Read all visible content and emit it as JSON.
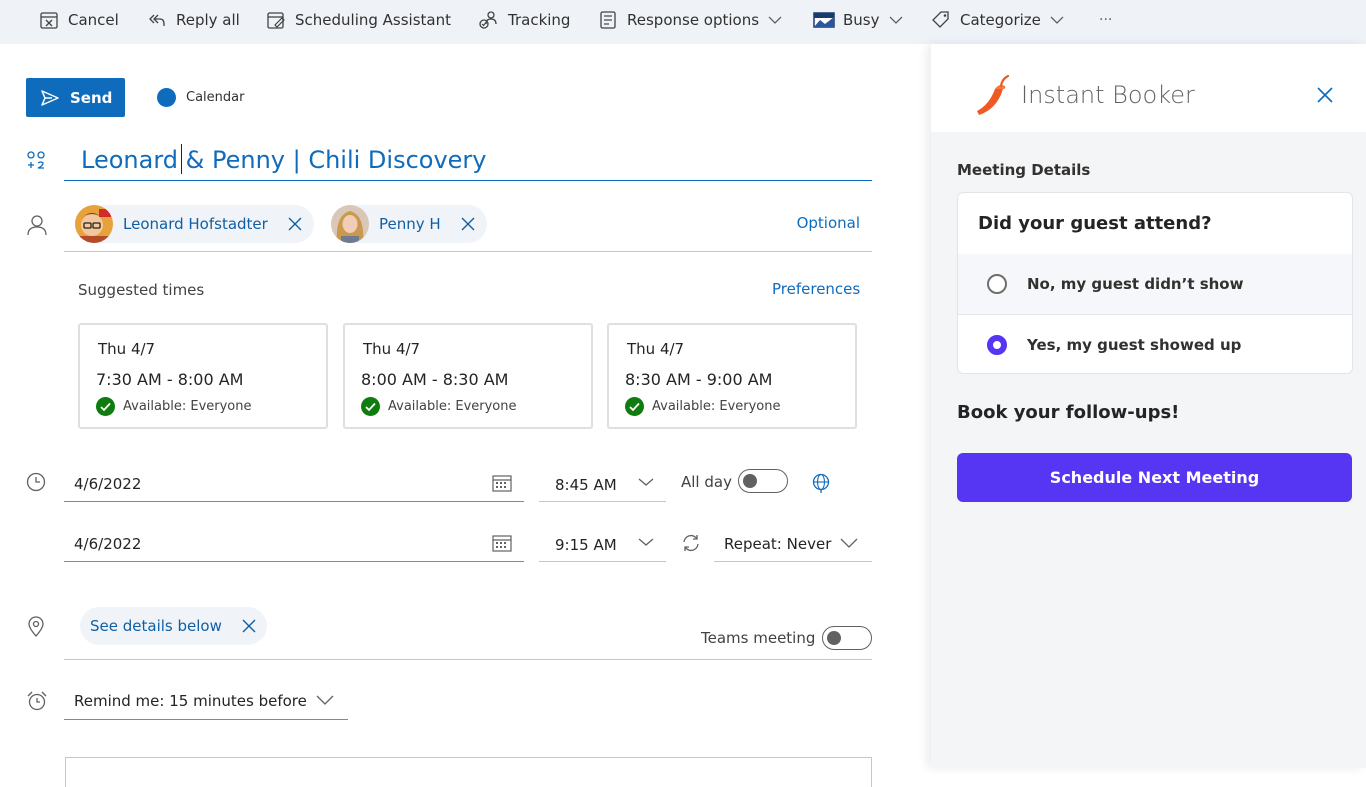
{
  "toolbar": {
    "cancel": "Cancel",
    "reply_all": "Reply all",
    "scheduling_assistant": "Scheduling Assistant",
    "tracking": "Tracking",
    "response_options": "Response options",
    "busy": "Busy",
    "categorize": "Categorize",
    "more": "···"
  },
  "compose": {
    "send_label": "Send",
    "calendar_label": "Calendar",
    "title": "Leonard & Penny | Chili Discovery",
    "optional_label": "Optional",
    "attendees": [
      {
        "name": "Leonard Hofstadter"
      },
      {
        "name": "Penny H"
      }
    ]
  },
  "suggested": {
    "label": "Suggested times",
    "preferences_label": "Preferences",
    "slots": [
      {
        "day": "Thu 4/7",
        "time": "7:30 AM - 8:00 AM",
        "availability": "Available: Everyone"
      },
      {
        "day": "Thu 4/7",
        "time": "8:00 AM - 8:30 AM",
        "availability": "Available: Everyone"
      },
      {
        "day": "Thu 4/7",
        "time": "8:30 AM - 9:00 AM",
        "availability": "Available: Everyone"
      }
    ]
  },
  "schedule": {
    "start_date": "4/6/2022",
    "start_time": "8:45 AM",
    "end_date": "4/6/2022",
    "end_time": "9:15 AM",
    "all_day_label": "All day",
    "repeat_label": "Repeat:",
    "repeat_value": "Never"
  },
  "location": {
    "chip_label": "See details below",
    "teams_label": "Teams meeting"
  },
  "reminder": {
    "label": "Remind me:",
    "value": "15 minutes before"
  },
  "panel": {
    "title": "Instant Booker",
    "meeting_details": "Meeting Details",
    "question": "Did your guest attend?",
    "option_no": "No, my guest didn’t show",
    "option_yes": "Yes, my guest showed up",
    "followups": "Book your follow-ups!",
    "schedule_button": "Schedule Next Meeting"
  },
  "colors": {
    "accent": "#0f6cbd",
    "booker_purple": "#5636f2",
    "available_green": "#107c10"
  }
}
